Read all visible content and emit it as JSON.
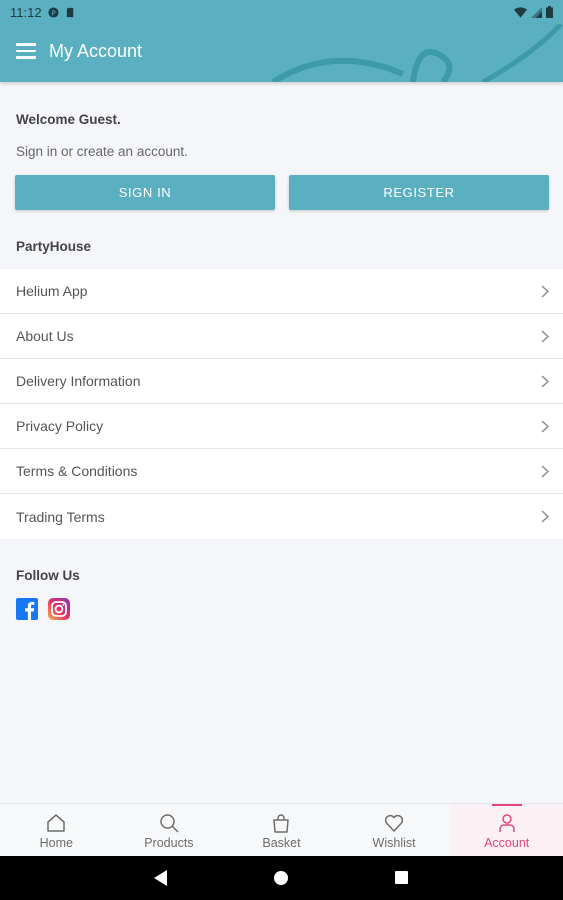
{
  "status_bar": {
    "time": "11:12"
  },
  "app_bar": {
    "title": "My Account"
  },
  "account": {
    "welcome": "Welcome Guest.",
    "subtext": "Sign in or create an account.",
    "sign_in_label": "SIGN IN",
    "register_label": "REGISTER"
  },
  "store": {
    "name": "PartyHouse",
    "items": [
      {
        "label": "Helium App"
      },
      {
        "label": "About Us"
      },
      {
        "label": "Delivery Information"
      },
      {
        "label": "Privacy Policy"
      },
      {
        "label": "Terms & Conditions"
      },
      {
        "label": "Trading Terms"
      }
    ]
  },
  "follow": {
    "title": "Follow Us",
    "icons": [
      "facebook-icon",
      "instagram-icon"
    ]
  },
  "bottom_nav": {
    "items": [
      {
        "label": "Home",
        "icon": "home-icon"
      },
      {
        "label": "Products",
        "icon": "search-icon"
      },
      {
        "label": "Basket",
        "icon": "basket-icon"
      },
      {
        "label": "Wishlist",
        "icon": "heart-icon"
      },
      {
        "label": "Account",
        "icon": "user-icon",
        "active": true
      }
    ]
  },
  "colors": {
    "accent": "#5aafc0",
    "active": "#e3457a",
    "facebook": "#1877f2"
  }
}
